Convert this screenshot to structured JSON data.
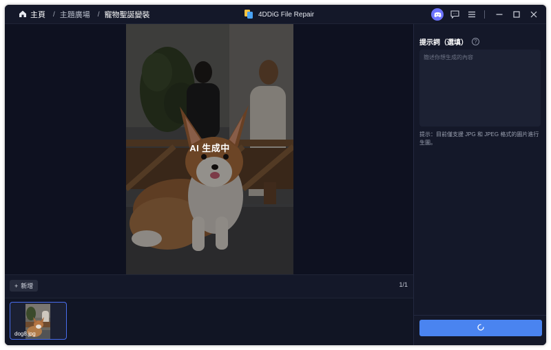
{
  "titlebar": {
    "breadcrumb": {
      "home": "主頁",
      "separator": "/",
      "middle": "主題廣場",
      "current": "寵物聖誕變裝"
    },
    "app_title": "4DDiG File Repair",
    "icons": [
      "discord-icon",
      "chat-icon",
      "menu-icon",
      "minimize-icon",
      "maximize-icon",
      "close-icon"
    ]
  },
  "preview": {
    "status_overlay": "AI 生成中"
  },
  "actionbar": {
    "add_label": "新增",
    "add_icon": "+",
    "counter": "1/1"
  },
  "thumbnails": [
    {
      "filename": "dog8.jpg",
      "selected": true
    }
  ],
  "prompt_panel": {
    "title": "提示詞（選填）",
    "help_icon": "?",
    "placeholder": "簡述你想生成的內容",
    "value": "",
    "hint": "提示：目前僅支援 JPG 和 JPEG 格式的圖片進行生圖。"
  },
  "generate_button": {
    "state": "loading",
    "icon": "spinner-icon"
  },
  "colors": {
    "window_bg": "#111524",
    "panel_bg": "#141829",
    "accent": "#4a84f0",
    "thumb_border": "#4a6ff0",
    "discord": "#6c73ff"
  }
}
